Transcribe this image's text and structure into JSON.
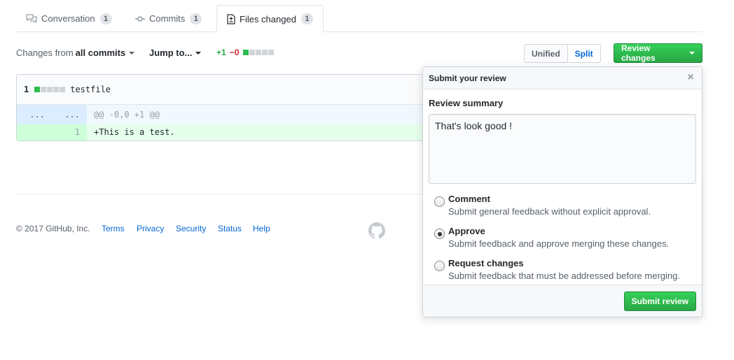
{
  "tabs": [
    {
      "label": "Conversation",
      "count": "1",
      "icon": "comment-discussion-icon"
    },
    {
      "label": "Commits",
      "count": "1",
      "icon": "git-commit-icon"
    },
    {
      "label": "Files changed",
      "count": "1",
      "icon": "file-diff-icon",
      "selected": true
    }
  ],
  "toolbar": {
    "changes_from_label": "Changes from",
    "changes_from_value": "all commits",
    "jump_to_label": "Jump to...",
    "additions": "+1",
    "deletions": "−0",
    "unified_label": "Unified",
    "split_label": "Split",
    "review_changes_label": "Review changes"
  },
  "file": {
    "change_count": "1",
    "name": "testfile",
    "hunk_left": "...",
    "hunk_right": "...",
    "hunk_header": "@@ -0,0 +1 @@",
    "lines": [
      {
        "new_number": "1",
        "content": "+This is a test."
      }
    ]
  },
  "footer": {
    "copyright": "© 2017 GitHub, Inc.",
    "links": [
      "Terms",
      "Privacy",
      "Security",
      "Status",
      "Help"
    ],
    "logo_icon": "github-mark-icon"
  },
  "review_popover": {
    "title": "Submit your review",
    "close_icon": "x-icon",
    "summary_label": "Review summary",
    "summary_text": "That's look good !",
    "options": [
      {
        "title": "Comment",
        "description": "Submit general feedback without explicit approval.",
        "checked": false
      },
      {
        "title": "Approve",
        "description": "Submit feedback and approve merging these changes.",
        "checked": true
      },
      {
        "title": "Request changes",
        "description": "Submit feedback that must be addressed before merging.",
        "checked": false
      }
    ],
    "submit_label": "Submit review"
  },
  "colors": {
    "accent_green": "#28a745",
    "link_blue": "#0366d6",
    "deletion_red": "#cb2431"
  }
}
